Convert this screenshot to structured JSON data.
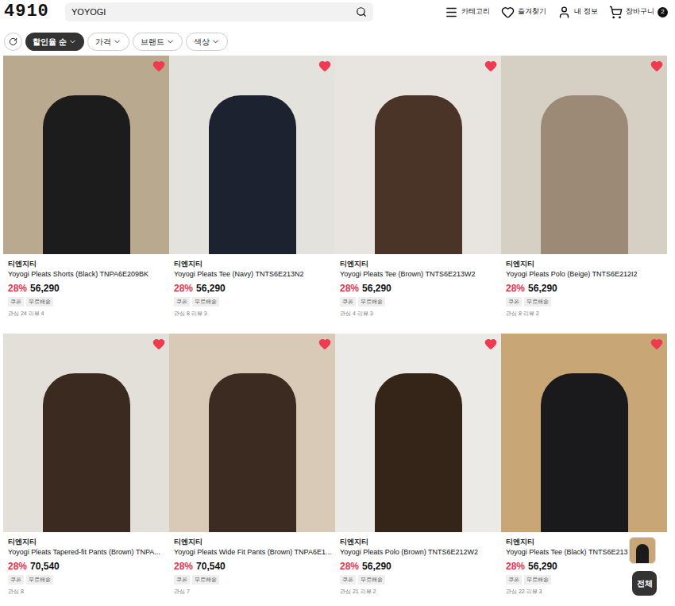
{
  "header": {
    "logo": "4910",
    "search": "YOYOGI",
    "nav": [
      {
        "label": "카테고리"
      },
      {
        "label": "즐겨찾기"
      },
      {
        "label": "내 정보"
      },
      {
        "label": "장바구니",
        "badge": "2"
      }
    ]
  },
  "filters": [
    {
      "label": "할인율 순",
      "selected": true
    },
    {
      "label": "가격",
      "selected": false
    },
    {
      "label": "브랜드",
      "selected": false
    },
    {
      "label": "색상",
      "selected": false
    }
  ],
  "products": [
    {
      "brand": "티엔지티",
      "name": "Yoyogi Pleats Shorts (Black) TNPA6E209BK",
      "discount": "28%",
      "price": "56,290",
      "badges": [
        "쿠폰",
        "무료배송"
      ],
      "stats": "관심 24 리뷰 4",
      "liked": true
    },
    {
      "brand": "티엔지티",
      "name": "Yoyogi Pleats Tee (Navy) TNTS6E213N2",
      "discount": "28%",
      "price": "56,290",
      "badges": [
        "쿠폰",
        "무료배송"
      ],
      "stats": "관심 8 리뷰 3",
      "liked": true
    },
    {
      "brand": "티엔지티",
      "name": "Yoyogi Pleats Tee (Brown) TNTS6E213W2",
      "discount": "28%",
      "price": "56,290",
      "badges": [
        "쿠폰",
        "무료배송"
      ],
      "stats": "관심 4 리뷰 3",
      "liked": true
    },
    {
      "brand": "티엔지티",
      "name": "Yoyogi Pleats Polo (Beige) TNTS6E212I2",
      "discount": "28%",
      "price": "56,290",
      "badges": [
        "쿠폰",
        "무료배송"
      ],
      "stats": "관심 8 리뷰 2",
      "liked": true
    },
    {
      "brand": "티엔지티",
      "name": "Yoyogi Pleats Tapered-fit Pants (Brown) TNPA...",
      "discount": "28%",
      "price": "70,540",
      "badges": [
        "쿠폰",
        "무료배송"
      ],
      "stats": "관심 8",
      "liked": true
    },
    {
      "brand": "티엔지티",
      "name": "Yoyogi Pleats Wide Fit Pants (Brown) TNPA6E1...",
      "discount": "28%",
      "price": "70,540",
      "badges": [
        "쿠폰",
        "무료배송"
      ],
      "stats": "관심 7",
      "liked": true
    },
    {
      "brand": "티엔지티",
      "name": "Yoyogi Pleats Polo (Brown) TNTS6E212W2",
      "discount": "28%",
      "price": "56,290",
      "badges": [
        "쿠폰",
        "무료배송"
      ],
      "stats": "관심 21 리뷰 2",
      "liked": true
    },
    {
      "brand": "티엔지티",
      "name": "Yoyogi Pleats Tee (Black) TNTS6E213",
      "discount": "28%",
      "price": "56,290",
      "badges": [
        "쿠폰",
        "무료배송"
      ],
      "stats": "관심 22 리뷰 3",
      "liked": true
    }
  ],
  "floating": {
    "button": "전체"
  }
}
